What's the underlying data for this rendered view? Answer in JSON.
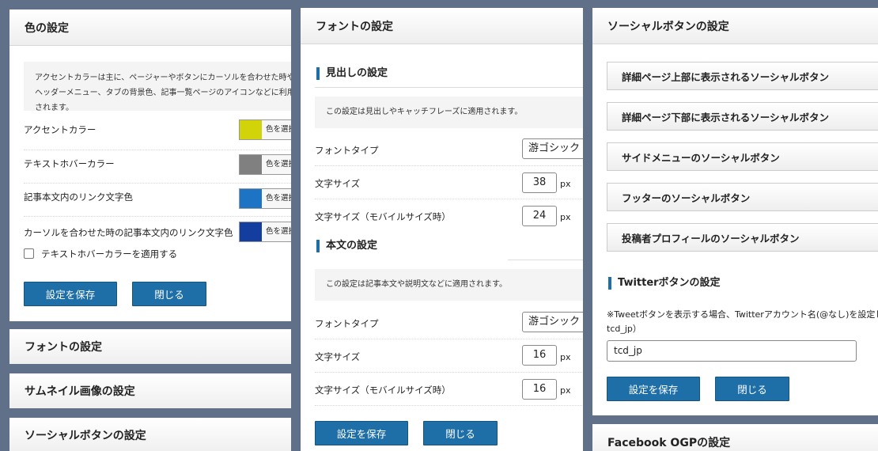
{
  "color_panel": {
    "title": "色の設定",
    "note": "アクセントカラーは主に、ページャーやボタンにカーソルを合わせた時やヘッダーメニュー、タブの背景色、記事一覧ページのアイコンなどに利用されます。",
    "rows": [
      {
        "label": "アクセントカラー",
        "color": "#d3d30a"
      },
      {
        "label": "テキストホバーカラー",
        "color": "#808080"
      },
      {
        "label": "記事本文内のリンク文字色",
        "color": "#1e74c4"
      },
      {
        "label": "カーソルを合わせた時の記事本文内のリンク文字色",
        "color": "#133ea0"
      }
    ],
    "pick_label": "色を選択",
    "checkbox_label": "テキストホバーカラーを適用する",
    "save": "設定を保存",
    "close": "閉じる"
  },
  "collapsed": [
    "フォントの設定",
    "サムネイル画像の設定",
    "ソーシャルボタンの設定"
  ],
  "font_panel": {
    "title": "フォントの設定",
    "heading_section": {
      "title": "見出しの設定",
      "note": "この設定は見出しやキャッチフレーズに適用されます。",
      "font_type_label": "フォントタイプ",
      "font_type_value": "游ゴシック",
      "size_label": "文字サイズ",
      "size_value": "38",
      "mobile_label": "文字サイズ（モバイルサイズ時）",
      "mobile_value": "24"
    },
    "body_section": {
      "title": "本文の設定",
      "note": "この設定は記事本文や説明文などに適用されます。",
      "font_type_label": "フォントタイプ",
      "font_type_value": "游ゴシック",
      "size_label": "文字サイズ",
      "size_value": "16",
      "mobile_label": "文字サイズ（モバイルサイズ時）",
      "mobile_value": "16"
    },
    "unit": "px",
    "save": "設定を保存",
    "close": "閉じる"
  },
  "social_panel": {
    "title": "ソーシャルボタンの設定",
    "buttons": [
      "詳細ページ上部に表示されるソーシャルボタン",
      "詳細ページ下部に表示されるソーシャルボタン",
      "サイドメニューのソーシャルボタン",
      "フッターのソーシャルボタン",
      "投稿者プロフィールのソーシャルボタン"
    ],
    "twitter_title": "Twitterボタンの設定",
    "twitter_note_1": "※Tweetボタンを表示する場合、Twitterアカウント名(@なし)を設定してください。（例：",
    "twitter_note_2": "tcd_jp）",
    "twitter_value": "tcd_jp",
    "save": "設定を保存",
    "close": "閉じる"
  },
  "facebook_panel": {
    "title": "Facebook OGPの設定"
  }
}
